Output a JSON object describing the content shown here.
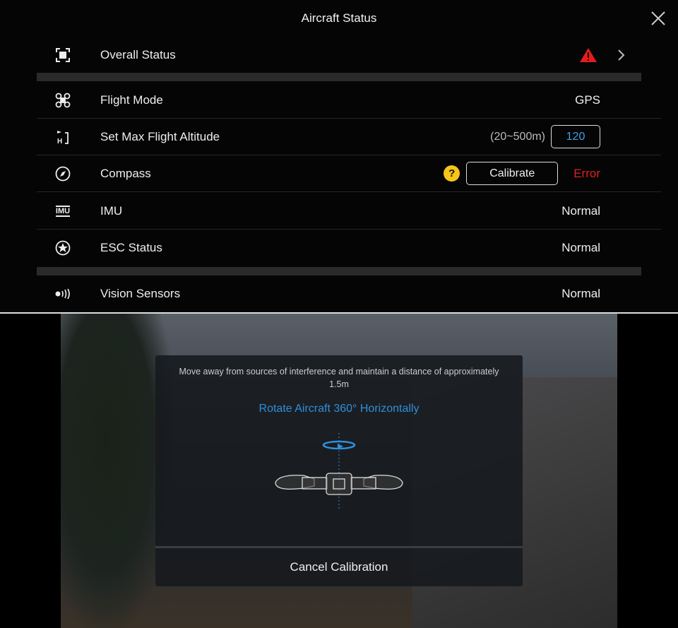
{
  "header": {
    "title": "Aircraft Status",
    "close_icon": "close-icon"
  },
  "rows": [
    {
      "icon": "overall-status-icon",
      "label": "Overall Status",
      "status_icon": "warning-triangle-icon"
    },
    {
      "icon": "drone-icon",
      "label": "Flight Mode",
      "value": "GPS"
    },
    {
      "icon": "altitude-icon",
      "label": "Set Max Flight Altitude",
      "range": "(20~500m)",
      "input_value": "120"
    },
    {
      "icon": "compass-icon",
      "label": "Compass",
      "help": "?",
      "button": "Calibrate",
      "value": "Error"
    },
    {
      "icon": "imu-icon",
      "label": "IMU",
      "icon_text": "IMU",
      "value": "Normal"
    },
    {
      "icon": "esc-icon",
      "label": "ESC Status",
      "value": "Normal"
    },
    {
      "icon": "vision-sensor-icon",
      "label": "Vision Sensors",
      "value": "Normal"
    }
  ],
  "dialog": {
    "message": "Move away from sources of interference and maintain a distance of approximately 1.5m",
    "instruction": "Rotate Aircraft 360° Horizontally",
    "cancel": "Cancel Calibration"
  },
  "colors": {
    "accent": "#2f8fd8",
    "error": "#e02020",
    "warning": "#e51c1c",
    "help": "#f5c518",
    "input_text": "#3aa0e8"
  }
}
